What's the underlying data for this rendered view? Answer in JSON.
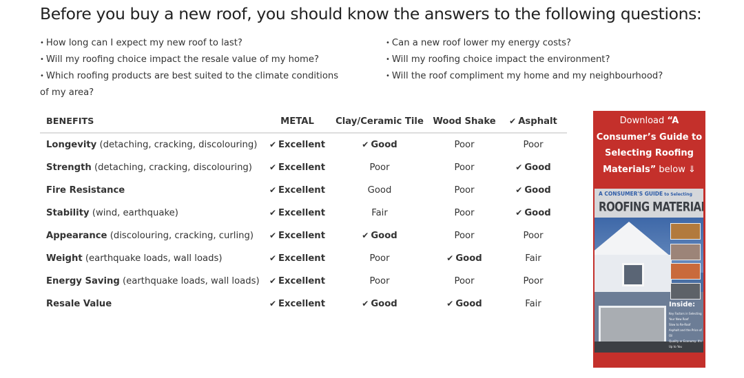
{
  "heading": "Before you buy a new roof, you should know the answers to the following questions:",
  "questions": {
    "left": [
      "How long can I expect my new roof to last?",
      "Will my roofing choice impact the resale value of my home?",
      "Which roofing products are best suited to the climate conditions of my area?"
    ],
    "right": [
      "Can a new roof lower my energy costs?",
      "Will my roofing choice impact the environment?",
      "Will the roof compliment my home and my neighbourhood?"
    ],
    "bullet": "•"
  },
  "table": {
    "check_icon": "✔",
    "headers": {
      "benefits": "BENEFITS",
      "metal": "METAL",
      "clay": "Clay/Ceramic Tile",
      "wood": "Wood Shake",
      "asphalt": "Asphalt",
      "asphalt_checked": true
    },
    "rows": [
      {
        "name": "Longevity",
        "detail": "(detaching, cracking, discolouring)",
        "metal": "Excellent",
        "metal_check": true,
        "clay": "Good",
        "clay_check": true,
        "wood": "Poor",
        "wood_check": false,
        "asphalt": "Poor",
        "asphalt_check": false
      },
      {
        "name": "Strength",
        "detail": "(detaching, cracking, discolouring)",
        "metal": "Excellent",
        "metal_check": true,
        "clay": "Poor",
        "clay_check": false,
        "wood": "Poor",
        "wood_check": false,
        "asphalt": "Good",
        "asphalt_check": true
      },
      {
        "name": "Fire Resistance",
        "detail": "",
        "metal": "Excellent",
        "metal_check": true,
        "clay": "Good",
        "clay_check": false,
        "wood": "Poor",
        "wood_check": false,
        "asphalt": "Good",
        "asphalt_check": true
      },
      {
        "name": "Stability",
        "detail": "(wind, earthquake)",
        "metal": "Excellent",
        "metal_check": true,
        "clay": "Fair",
        "clay_check": false,
        "wood": "Poor",
        "wood_check": false,
        "asphalt": "Good",
        "asphalt_check": true
      },
      {
        "name": "Appearance",
        "detail": "(discolouring, cracking, curling)",
        "metal": "Excellent",
        "metal_check": true,
        "clay": "Good",
        "clay_check": true,
        "wood": "Poor",
        "wood_check": false,
        "asphalt": "Poor",
        "asphalt_check": false
      },
      {
        "name": "Weight",
        "detail": "(earthquake loads, wall loads)",
        "metal": "Excellent",
        "metal_check": true,
        "clay": "Poor",
        "clay_check": false,
        "wood": "Good",
        "wood_check": true,
        "asphalt": "Fair",
        "asphalt_check": false
      },
      {
        "name": "Energy Saving",
        "detail": "(earthquake loads, wall loads)",
        "metal": "Excellent",
        "metal_check": true,
        "clay": "Poor",
        "clay_check": false,
        "wood": "Poor",
        "wood_check": false,
        "asphalt": "Poor",
        "asphalt_check": false
      },
      {
        "name": "Resale Value",
        "detail": "",
        "metal": "Excellent",
        "metal_check": true,
        "clay": "Good",
        "clay_check": true,
        "wood": "Good",
        "wood_check": true,
        "asphalt": "Fair",
        "asphalt_check": false
      }
    ]
  },
  "promo": {
    "prefix": "Download ",
    "title": "“A Consumer’s Guide to Selecting Roofing Materials”",
    "suffix": " below ",
    "arrow_icon": "⇓",
    "background": "#c4302b",
    "cover": {
      "subtitle_big": "A CONSUMER'S GUIDE",
      "subtitle_small": " to Selecting",
      "title": "ROOFING MATERIALS",
      "inside_label": "Inside:",
      "inside_items": [
        "Key Factors in Selecting Your New Roof",
        "Slow to Re-Roof",
        "Asphalt and the Price of Oil",
        "Quality or Economy: It's Up to You"
      ]
    }
  }
}
